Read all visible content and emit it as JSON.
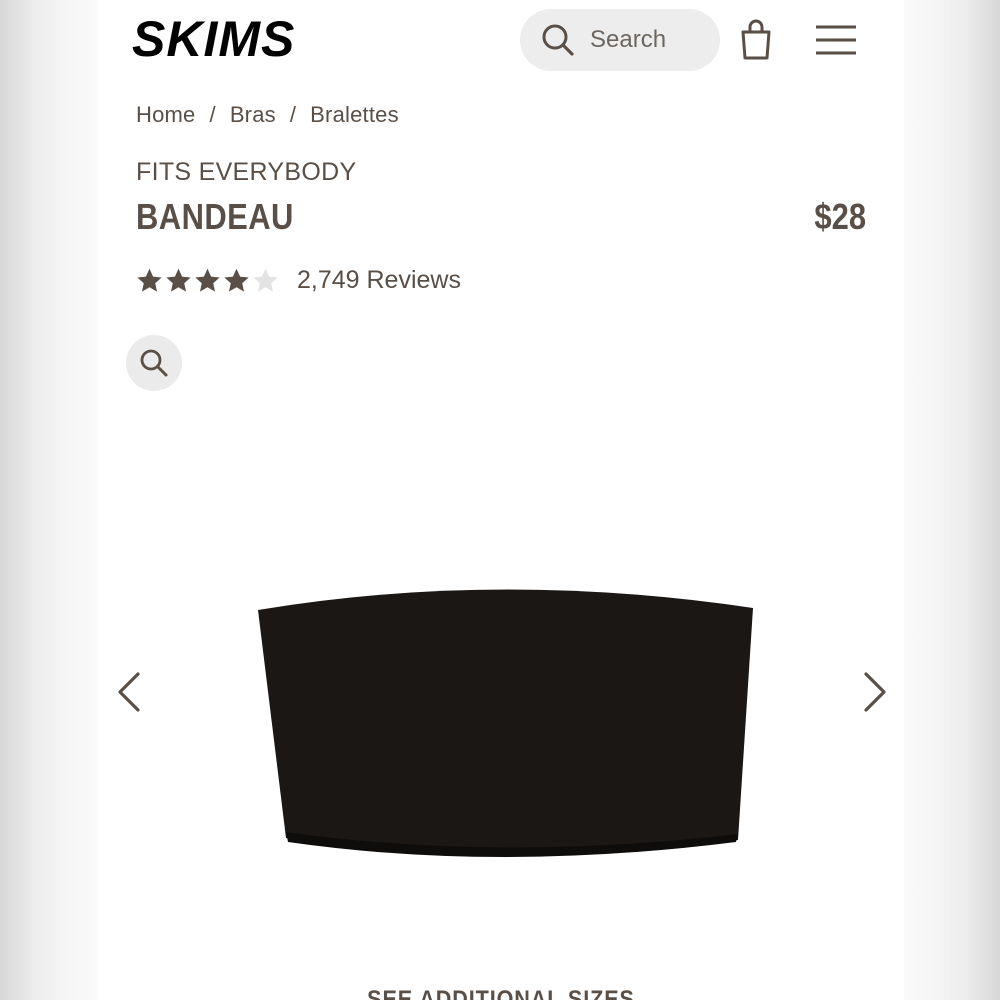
{
  "header": {
    "brand": "SKIMS",
    "search_placeholder": "Search",
    "icons": {
      "search": "search-icon",
      "bag": "shopping-bag-icon",
      "menu": "hamburger-menu-icon"
    }
  },
  "breadcrumb": {
    "items": [
      "Home",
      "Bras",
      "Bralettes"
    ],
    "separator": "/"
  },
  "product": {
    "eyebrow": "FITS EVERYBODY",
    "name": "BANDEAU",
    "price": "$28",
    "rating": 4.5,
    "rating_max": 5,
    "reviews_label": "2,749 Reviews",
    "image_alt": "Black strapless bandeau bra"
  },
  "gallery": {
    "zoom_icon": "zoom-icon",
    "prev_icon": "chevron-left-icon",
    "next_icon": "chevron-right-icon"
  },
  "sizes_link": "SEE ADDITIONAL SIZES",
  "colors": {
    "text": "#5a4f47",
    "pill_bg": "#ededed",
    "star_filled": "#5a4f47",
    "star_empty": "#e3e3e3",
    "product": "#1a1715"
  }
}
